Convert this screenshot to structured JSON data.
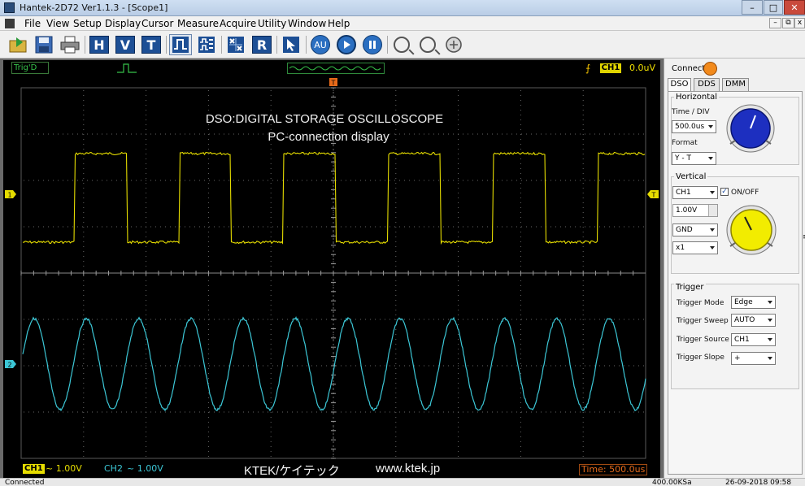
{
  "window": {
    "title": "Hantek-2D72 Ver1.1.3 - [Scope1]",
    "min_label": "–",
    "max_label": "□",
    "close_label": "✕"
  },
  "menu": {
    "items": [
      "File",
      "View",
      "Setup",
      "Display",
      "Cursor",
      "Measure",
      "Acquire",
      "Utility",
      "Window",
      "Help"
    ],
    "mdi_min": "–",
    "mdi_restore": "⧉",
    "mdi_close": "x"
  },
  "toolbar": {
    "icons": [
      "open-icon",
      "save-icon",
      "print-icon",
      "h-icon",
      "v-icon",
      "t-icon",
      "single-wave-icon",
      "multi-wave-icon",
      "xy-icon",
      "r-icon",
      "cursor-icon",
      "auto-icon",
      "run-icon",
      "pause-icon",
      "zoom-in-icon",
      "zoom-out-icon",
      "fit-icon"
    ],
    "h_label": "H",
    "v_label": "V",
    "t_label": "T",
    "r_label": "R",
    "auto_label": "AU"
  },
  "scope": {
    "trig_status": "Trig'D",
    "trigger_source_tag": "CH1",
    "trigger_level": "0.0uV",
    "trigger_marker": "T",
    "ch1_marker": "1",
    "ch2_marker": "2",
    "screen_title": "DSO:DIGITAL STORAGE OSCILLOSCOPE",
    "screen_subtitle": "PC-connection display",
    "ch1_tag": "CH1",
    "ch1_info": "~  1.00V",
    "ch2_tag": "CH2",
    "ch2_info": "~  1.00V",
    "brand": "KTEK/ケイテック",
    "site": "www.ktek.jp",
    "time_div": "Time: 500.0us",
    "ch1_color": "#e6dd00",
    "ch2_color": "#3cc7d6"
  },
  "panel": {
    "connect_label": "Connect:",
    "connect_color": "#f28a1c",
    "tabs": [
      "DSO",
      "DDS",
      "DMM"
    ],
    "active_tab": "DSO",
    "horizontal": {
      "title": "Horizontal",
      "time_div_label": "Time / DIV",
      "time_div_value": "500.0us",
      "format_label": "Format",
      "format_value": "Y - T",
      "knob_color": "#1d2fc0"
    },
    "vertical": {
      "title": "Vertical",
      "channel_value": "CH1",
      "onoff_label": "ON/OFF",
      "onoff_checked": true,
      "volts_value": "1.00V",
      "coupling_value": "GND",
      "probe_value": "x1",
      "knob_color": "#f2ec00"
    },
    "trigger": {
      "title": "Trigger",
      "mode_label": "Trigger Mode",
      "mode_value": "Edge",
      "sweep_label": "Trigger Sweep",
      "sweep_value": "AUTO",
      "source_label": "Trigger Source",
      "source_value": "CH1",
      "slope_label": "Trigger Slope",
      "slope_value": "+"
    },
    "side_arrow": "≡"
  },
  "status": {
    "text": "Connected",
    "rate": "400.00KSa",
    "datetime": "26-09-2018  09:58"
  }
}
